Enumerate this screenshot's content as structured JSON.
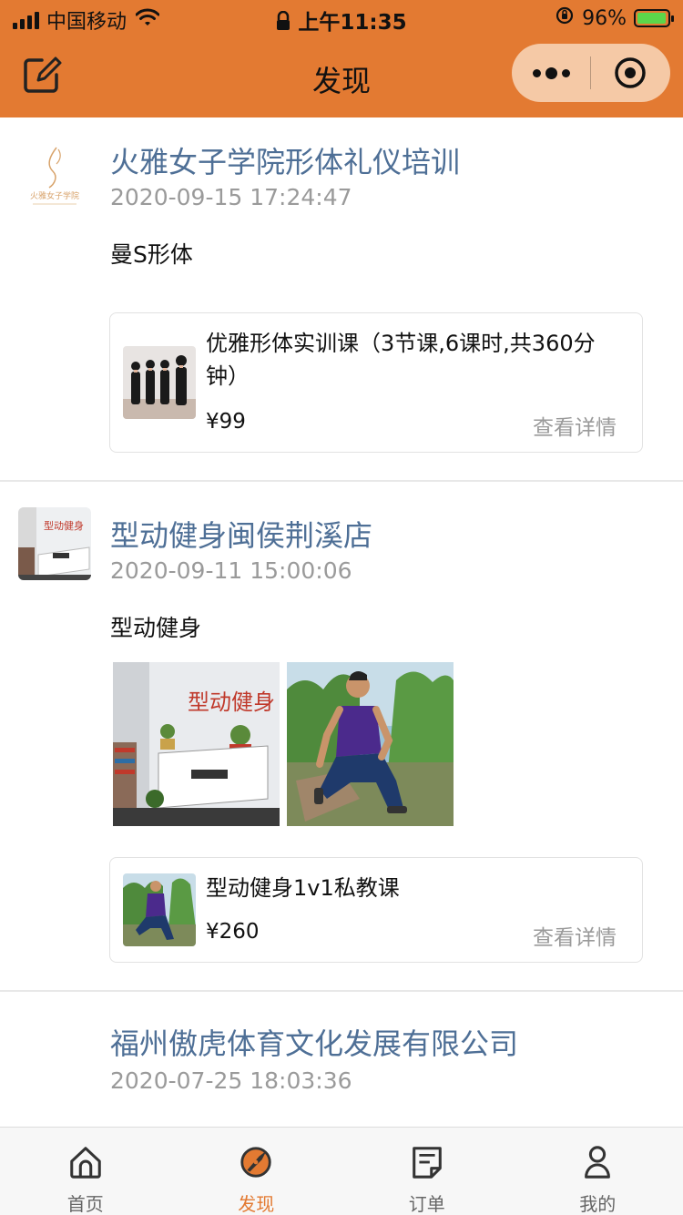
{
  "status_bar": {
    "carrier": "中国移动",
    "time": "上午11:35",
    "battery": "96%",
    "battery_level": 0.96
  },
  "nav": {
    "title": "发现"
  },
  "posts": [
    {
      "shop_name": "火雅女子学院形体礼仪培训",
      "logo_text": "火雅女子学院",
      "time": "2020-09-15 17:24:47",
      "text": "曼S形体",
      "course": {
        "name": "优雅形体实训课（3节课,6课时,共360分钟）",
        "price": "¥99",
        "detail": "查看详情"
      }
    },
    {
      "shop_name": "型动健身闽侯荆溪店",
      "time": "2020-09-11 15:00:06",
      "text": "型动健身",
      "course": {
        "name": "型动健身1v1私教课",
        "price": "¥260",
        "detail": "查看详情"
      }
    },
    {
      "shop_name": "福州傲虎体育文化发展有限公司",
      "time": "2020-07-25 18:03:36"
    }
  ],
  "tabs": [
    {
      "label": "首页",
      "icon": "home-icon"
    },
    {
      "label": "发现",
      "icon": "discover-icon"
    },
    {
      "label": "订单",
      "icon": "order-icon"
    },
    {
      "label": "我的",
      "icon": "profile-icon"
    }
  ],
  "colors": {
    "brand": "#e37a32",
    "link": "#4e6f96",
    "muted": "#9a9a9a"
  }
}
